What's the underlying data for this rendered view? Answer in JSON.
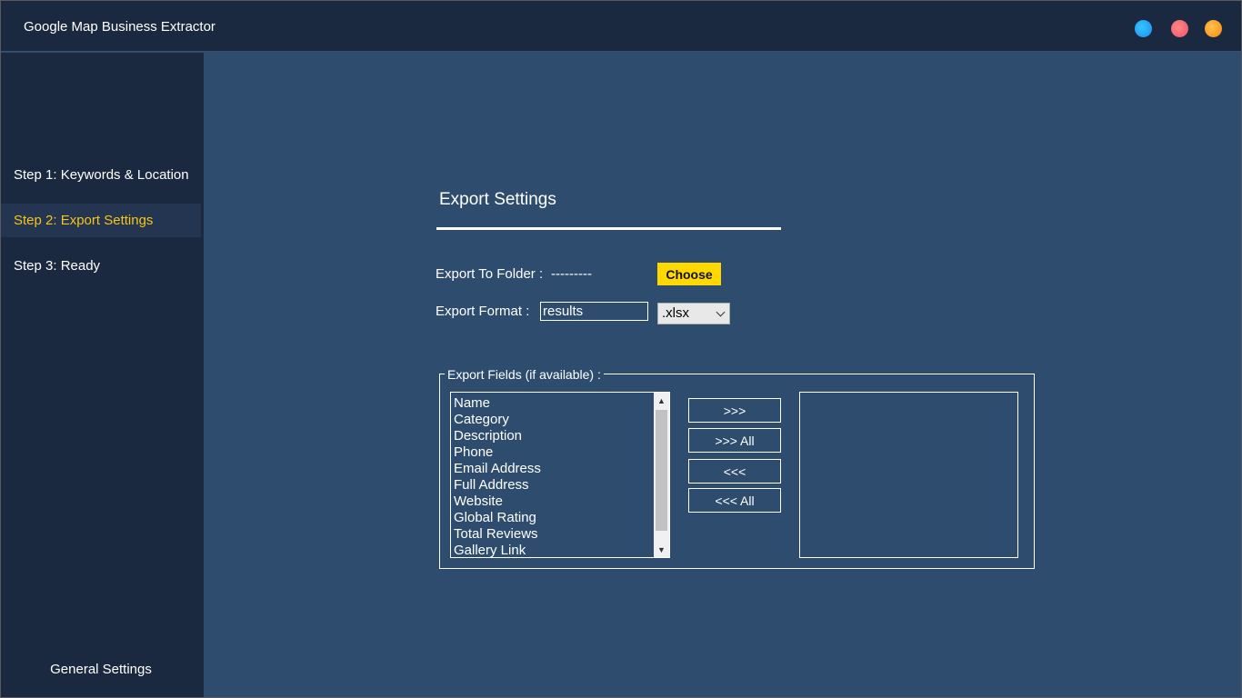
{
  "window": {
    "title": "Google Map Business Extractor",
    "controls": [
      "blue-dot",
      "pink-dot",
      "orange-dot"
    ]
  },
  "sidebar": {
    "items": [
      {
        "label": "Step 1: Keywords & Location",
        "active": false
      },
      {
        "label": "Step 2: Export Settings",
        "active": true
      },
      {
        "label": "Step 3: Ready",
        "active": false
      }
    ],
    "footer": "General Settings"
  },
  "main": {
    "section_title": "Export Settings",
    "export_folder": {
      "label": "Export To Folder :",
      "value": "---------",
      "button": "Choose"
    },
    "export_format": {
      "label": "Export Format :",
      "filename_value": "results",
      "format_selected": ".xlsx"
    },
    "fields": {
      "legend": "Export Fields (if available) :",
      "available": [
        "Name",
        "Category",
        "Description",
        "Phone",
        "Email Address",
        "Full Address",
        "Website",
        "Global Rating",
        "Total Reviews",
        "Gallery Link"
      ],
      "selected": [],
      "buttons": {
        "add": ">>>",
        "add_all": ">>> All",
        "remove": "<<<",
        "remove_all": "<<< All"
      }
    }
  },
  "colors": {
    "titlebar_bg": "#1b2940",
    "main_bg": "#2e4d6e",
    "accent_yellow": "#ffd800",
    "active_nav_text": "#f5c518"
  }
}
